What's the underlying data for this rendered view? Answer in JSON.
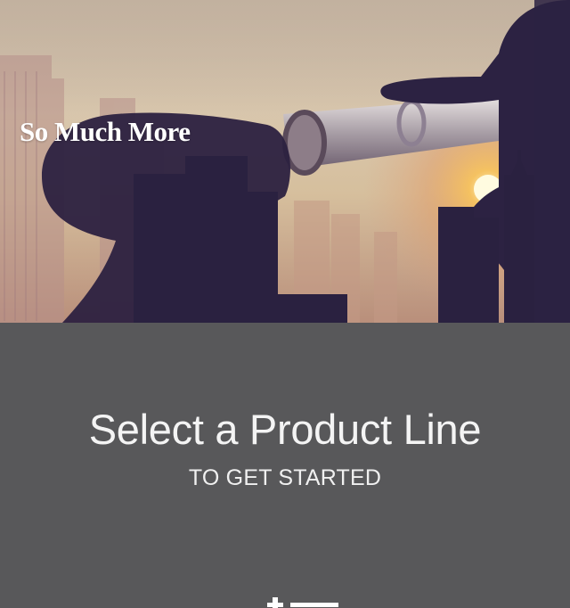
{
  "hero": {
    "title": "So Much More",
    "image": "telescope-silhouette-city-sunset"
  },
  "panel": {
    "heading": "Select a Product Line",
    "subheading": "TO GET STARTED",
    "icon": "list-icon"
  },
  "colors": {
    "panel_background": "#58585a",
    "heading_text": "#f4f4f4"
  }
}
